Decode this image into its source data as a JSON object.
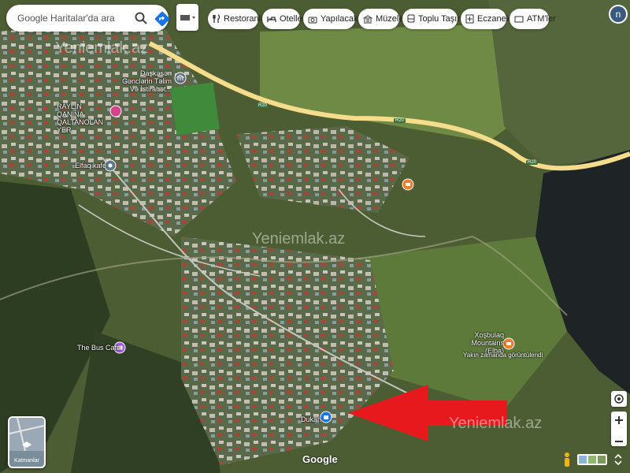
{
  "search": {
    "placeholder": "Google Haritalar'da ara"
  },
  "chips": [
    {
      "label": "Restoranlar",
      "icon": "fork-knife-icon"
    },
    {
      "label": "Oteller",
      "icon": "bed-icon"
    },
    {
      "label": "Yapılacaklar",
      "icon": "camera-icon"
    },
    {
      "label": "Müzeler",
      "icon": "museum-icon"
    },
    {
      "label": "Toplu Taşıma",
      "icon": "bus-icon"
    },
    {
      "label": "Eczaneler",
      "icon": "pharmacy-icon"
    },
    {
      "label": "ATM'ler",
      "icon": "atm-icon"
    }
  ],
  "account": {
    "initial": "n"
  },
  "places": [
    {
      "name": "Daşkəsən Gənclərin Təlim Və İstirahət...",
      "icon": "museum-icon"
    },
    {
      "name": "RAYLIN QANINA QALTANOLAN YER",
      "icon": "heart-pin-icon"
    },
    {
      "name": "Elfaq kafe",
      "icon": "pin-icon"
    },
    {
      "name": "The Bus Cafe",
      "icon": "photo-pin-icon"
    },
    {
      "name": "Xoşbulaq Mountains (Elba)",
      "note": "Yakın zamanda görüntülendi",
      "icon": "hotel-pin-icon"
    },
    {
      "name": "Dukan",
      "icon": "shop-pin-icon"
    }
  ],
  "road": {
    "label": "R20"
  },
  "watermark": "Yeniemlak.az",
  "layers_label": "Katmanlar",
  "logo": "Google",
  "colors": {
    "pin_orange": "#f07b28",
    "pin_purple": "#a659d9",
    "pin_blue": "#1a73e8",
    "arrow": "#e8191c",
    "road": "#f5dd8c"
  }
}
